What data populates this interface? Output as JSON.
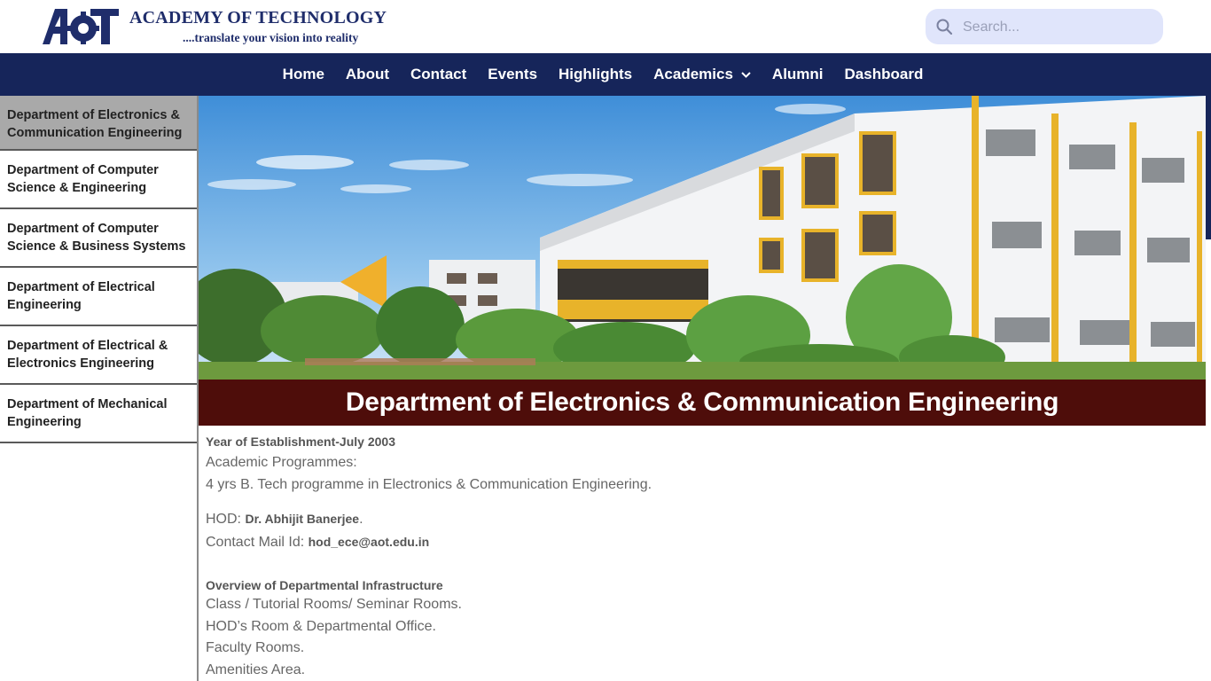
{
  "header": {
    "logo_text": "AOT",
    "brand_name": "ACADEMY OF TECHNOLOGY",
    "tagline": "....translate your vision into reality",
    "search_placeholder": "Search..."
  },
  "nav": {
    "items": [
      "Home",
      "About",
      "Contact",
      "Events",
      "Highlights",
      "Academics",
      "Alumni",
      "Dashboard"
    ]
  },
  "sidebar": {
    "items": [
      "Department of Electronics & Communication Engineering",
      "Department of Computer Science & Engineering",
      "Department of Computer Science & Business Systems",
      "Department of Electrical Engineering",
      "Department of Electrical & Electronics Engineering",
      "Department of Mechanical Engineering"
    ]
  },
  "main": {
    "title": "Department of Electronics & Communication Engineering",
    "year": "Year of Establishment-July 2003",
    "programmes_label": "Academic Programmes:",
    "programme": "4 yrs B. Tech programme in Electronics & Communication Engineering.",
    "hod_label": "HOD: ",
    "hod_name": "Dr. Abhijit Banerjee",
    "hod_suffix": ".",
    "mail_label": "Contact Mail Id: ",
    "mail": "hod_ece@aot.edu.in",
    "infra_heading": "Overview of Departmental Infrastructure",
    "infra": [
      "Class / Tutorial Rooms/ Seminar Rooms.",
      "HOD’s Room & Departmental Office.",
      "Faculty Rooms.",
      "Amenities Area."
    ]
  },
  "colors": {
    "nav_bg": "#16255a",
    "brand": "#1f2d6b",
    "title_bar": "#4e0d0a",
    "active_sidebar": "#a9a9a9",
    "search_bg": "#e0e5fb"
  },
  "icons": {
    "search": "search-icon",
    "dropdown": "chevron-down-icon",
    "logo": "aot-logo-icon"
  }
}
